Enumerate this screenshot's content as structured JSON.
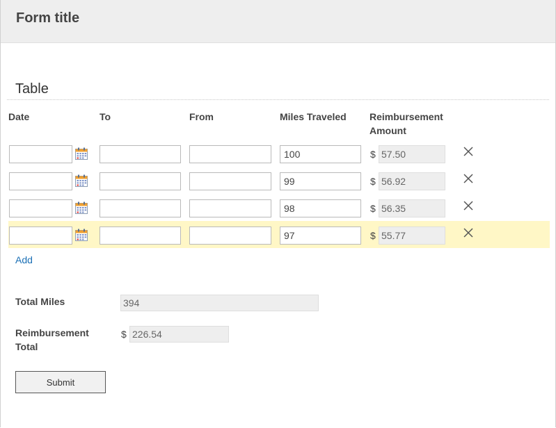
{
  "form": {
    "title": "Form title",
    "section_title": "Table"
  },
  "table": {
    "columns": [
      "Date",
      "To",
      "From",
      "Miles Traveled",
      "Reimbursement Amount"
    ],
    "currency_symbol": "$",
    "rows": [
      {
        "date": "",
        "to": "",
        "from": "",
        "miles": "100",
        "amount": "57.50",
        "highlighted": false
      },
      {
        "date": "",
        "to": "",
        "from": "",
        "miles": "99",
        "amount": "56.92",
        "highlighted": false
      },
      {
        "date": "",
        "to": "",
        "from": "",
        "miles": "98",
        "amount": "56.35",
        "highlighted": false
      },
      {
        "date": "",
        "to": "",
        "from": "",
        "miles": "97",
        "amount": "55.77",
        "highlighted": true
      }
    ],
    "add_label": "Add"
  },
  "totals": {
    "total_miles_label": "Total Miles",
    "total_miles_value": "394",
    "reimbursement_label_line1": "Reimbursement",
    "reimbursement_label_line2": "Total",
    "reimbursement_currency": "$",
    "reimbursement_value": "226.54"
  },
  "actions": {
    "submit_label": "Submit"
  },
  "icons": {
    "calendar": "calendar-icon",
    "remove": "close-icon"
  },
  "colors": {
    "header_bg": "#eeeeee",
    "highlight_row": "#fff7c6",
    "link": "#1a6fb5",
    "readonly_bg": "#eeeeee"
  }
}
